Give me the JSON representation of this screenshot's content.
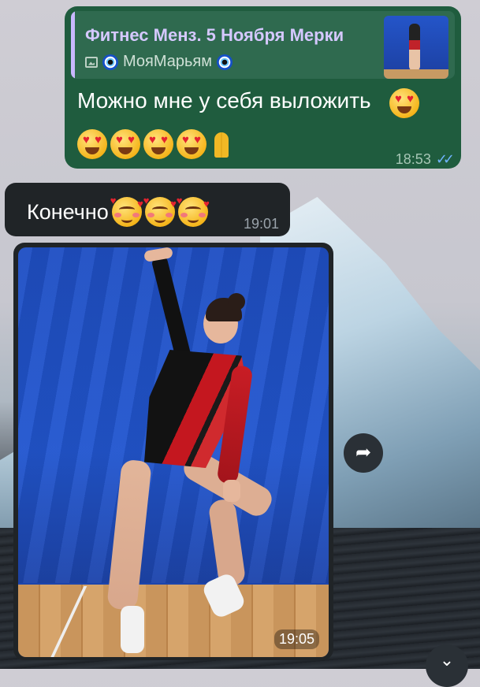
{
  "messages": {
    "outgoing": {
      "reply": {
        "title": "Фитнес Менз. 5 Ноября Мерки",
        "author": "МояМарьям",
        "media_icon": "image-icon",
        "author_emoji": "nazar-amulet-emoji"
      },
      "text": "Можно мне у себя выложить",
      "emojis": [
        "smiling-face-with-heart-eyes",
        "smiling-face-with-heart-eyes",
        "smiling-face-with-heart-eyes",
        "smiling-face-with-heart-eyes",
        "smiling-face-with-heart-eyes",
        "folded-hands"
      ],
      "time": "18:53",
      "status_icon": "double-check-read-icon",
      "status_color": "#6fb4ff"
    },
    "incoming_text": {
      "text": "Конечно",
      "emojis": [
        "smiling-face-with-hearts",
        "smiling-face-with-hearts",
        "smiling-face-with-hearts"
      ],
      "time": "19:01"
    },
    "incoming_photo": {
      "time": "19:05"
    }
  },
  "controls": {
    "forward_icon": "forward-icon",
    "scroll_down_icon": "chevron-double-down-icon"
  },
  "colors": {
    "outgoing_bubble": "#1f5c3e",
    "incoming_bubble": "#202427",
    "reply_accent": "#c9b8ff"
  }
}
